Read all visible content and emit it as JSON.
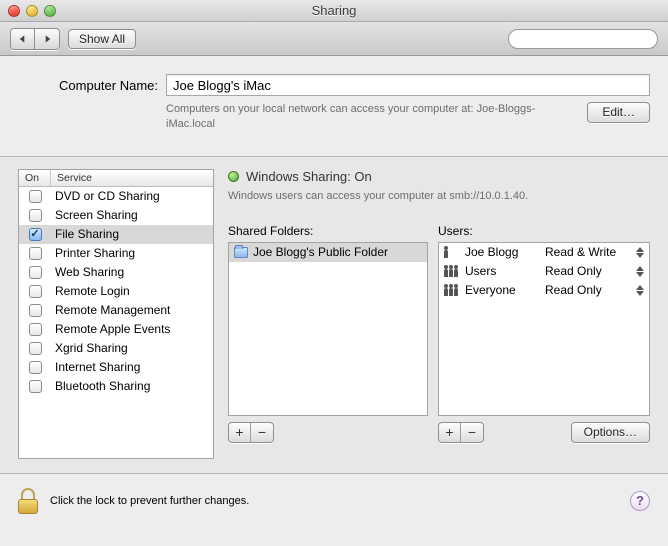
{
  "window": {
    "title": "Sharing"
  },
  "toolbar": {
    "show_all_label": "Show All",
    "search_placeholder": ""
  },
  "computer_name": {
    "label": "Computer Name:",
    "value": "Joe Blogg's iMac",
    "description": "Computers on your local network can access your computer at: Joe-Bloggs-iMac.local",
    "edit_label": "Edit…"
  },
  "services": {
    "head_on": "On",
    "head_service": "Service",
    "items": [
      {
        "label": "DVD or CD Sharing",
        "checked": false,
        "selected": false
      },
      {
        "label": "Screen Sharing",
        "checked": false,
        "selected": false
      },
      {
        "label": "File Sharing",
        "checked": true,
        "selected": true
      },
      {
        "label": "Printer Sharing",
        "checked": false,
        "selected": false
      },
      {
        "label": "Web Sharing",
        "checked": false,
        "selected": false
      },
      {
        "label": "Remote Login",
        "checked": false,
        "selected": false
      },
      {
        "label": "Remote Management",
        "checked": false,
        "selected": false
      },
      {
        "label": "Remote Apple Events",
        "checked": false,
        "selected": false
      },
      {
        "label": "Xgrid Sharing",
        "checked": false,
        "selected": false
      },
      {
        "label": "Internet Sharing",
        "checked": false,
        "selected": false
      },
      {
        "label": "Bluetooth Sharing",
        "checked": false,
        "selected": false
      }
    ]
  },
  "status": {
    "title": "Windows Sharing: On",
    "subtitle": "Windows users can access your computer at smb://10.0.1.40."
  },
  "folders": {
    "label": "Shared Folders:",
    "items": [
      {
        "label": "Joe Blogg's Public Folder",
        "selected": true
      }
    ]
  },
  "users": {
    "label": "Users:",
    "items": [
      {
        "name": "Joe Blogg",
        "perm": "Read & Write",
        "type": "single"
      },
      {
        "name": "Users",
        "perm": "Read Only",
        "type": "group"
      },
      {
        "name": "Everyone",
        "perm": "Read Only",
        "type": "group"
      }
    ]
  },
  "buttons": {
    "options": "Options…"
  },
  "footer": {
    "lock_text": "Click the lock to prevent further changes."
  }
}
